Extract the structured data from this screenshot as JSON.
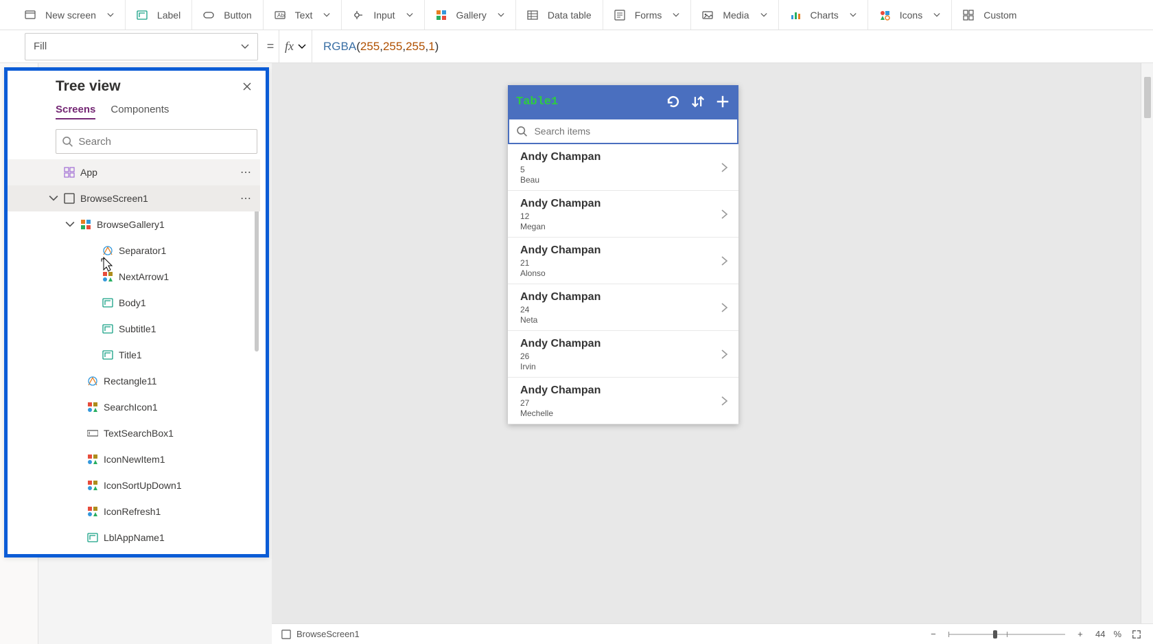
{
  "ribbon": {
    "new_screen": "New screen",
    "label": "Label",
    "button": "Button",
    "text": "Text",
    "input": "Input",
    "gallery": "Gallery",
    "data_table": "Data table",
    "forms": "Forms",
    "media": "Media",
    "charts": "Charts",
    "icons": "Icons",
    "custom": "Custom"
  },
  "propbar": {
    "property": "Fill",
    "formula_func": "RGBA",
    "formula_args": [
      "255",
      "255",
      "255",
      "1"
    ]
  },
  "treeview": {
    "title": "Tree view",
    "tab_screens": "Screens",
    "tab_components": "Components",
    "search_placeholder": "Search",
    "items": [
      {
        "label": "App",
        "indent": 1,
        "icon": "grid",
        "more": true,
        "hovered": true
      },
      {
        "label": "BrowseScreen1",
        "indent": 1,
        "icon": "screen",
        "chev": "down",
        "more": true,
        "selected": true
      },
      {
        "label": "BrowseGallery1",
        "indent": 2,
        "icon": "gallery",
        "chev": "down"
      },
      {
        "label": "Separator1",
        "indent": 4,
        "icon": "shape"
      },
      {
        "label": "NextArrow1",
        "indent": 4,
        "icon": "iconctl"
      },
      {
        "label": "Body1",
        "indent": 4,
        "icon": "labelctl"
      },
      {
        "label": "Subtitle1",
        "indent": 4,
        "icon": "labelctl"
      },
      {
        "label": "Title1",
        "indent": 4,
        "icon": "labelctl"
      },
      {
        "label": "Rectangle11",
        "indent": 3,
        "icon": "shape"
      },
      {
        "label": "SearchIcon1",
        "indent": 3,
        "icon": "iconctl"
      },
      {
        "label": "TextSearchBox1",
        "indent": 3,
        "icon": "textinput"
      },
      {
        "label": "IconNewItem1",
        "indent": 3,
        "icon": "iconctl"
      },
      {
        "label": "IconSortUpDown1",
        "indent": 3,
        "icon": "iconctl"
      },
      {
        "label": "IconRefresh1",
        "indent": 3,
        "icon": "iconctl"
      },
      {
        "label": "LblAppName1",
        "indent": 3,
        "icon": "labelctl"
      }
    ]
  },
  "phone": {
    "title": "Table1",
    "search_placeholder": "Search items",
    "rows": [
      {
        "name": "Andy Champan",
        "num": "5",
        "sub": "Beau"
      },
      {
        "name": "Andy Champan",
        "num": "12",
        "sub": "Megan"
      },
      {
        "name": "Andy Champan",
        "num": "21",
        "sub": "Alonso"
      },
      {
        "name": "Andy Champan",
        "num": "24",
        "sub": "Neta"
      },
      {
        "name": "Andy Champan",
        "num": "26",
        "sub": "Irvin"
      },
      {
        "name": "Andy Champan",
        "num": "27",
        "sub": "Mechelle"
      }
    ]
  },
  "statusbar": {
    "screen": "BrowseScreen1",
    "zoom_value": "44",
    "zoom_unit": "%"
  }
}
